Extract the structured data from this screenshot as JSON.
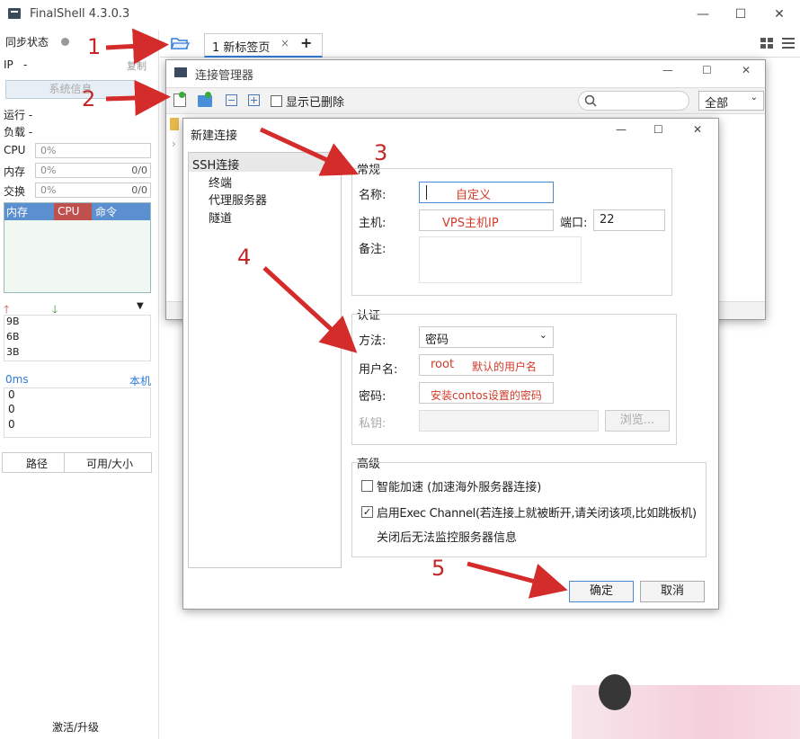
{
  "app": {
    "title": "FinalShell 4.3.0.3"
  },
  "left": {
    "sync_label": "同步状态",
    "ip_label": "IP",
    "ip_value": "-",
    "copy": "复制",
    "sysinfo": "系统信息",
    "run": "运行 -",
    "load": "负载 -",
    "meters": [
      {
        "label": "CPU",
        "value": "0%",
        "right": ""
      },
      {
        "label": "内存",
        "value": "0%",
        "right": "0/0"
      },
      {
        "label": "交换",
        "value": "0%",
        "right": "0/0"
      }
    ],
    "proc_tabs": [
      "内存",
      "CPU",
      "命令"
    ],
    "net_vals": [
      "9B",
      "6B",
      "3B"
    ],
    "ping": "0ms",
    "host": "本机",
    "ping_vals": [
      "0",
      "0",
      "0"
    ],
    "path": "路径",
    "size": "可用/大小",
    "activate": "激活/升级"
  },
  "tabs": {
    "label": "1 新标签页",
    "close": "×",
    "add": "+"
  },
  "conn_mgr": {
    "title": "连接管理器",
    "show_deleted": "显示已删除",
    "filter": "全部"
  },
  "dialog": {
    "title": "新建连接",
    "tree": [
      "SSH连接",
      "终端",
      "代理服务器",
      "隧道"
    ],
    "general": "常规",
    "name_label": "名称:",
    "name_value": "自定义",
    "host_label": "主机:",
    "host_value": "VPS主机IP",
    "port_label": "端口:",
    "port_value": "22",
    "note_label": "备注:",
    "auth": "认证",
    "method_label": "方法:",
    "method_value": "密码",
    "user_label": "用户名:",
    "user_value": "root",
    "user_note": "默认的用户名",
    "pass_label": "密码:",
    "pass_note": "安装contos设置的密码",
    "key_label": "私钥:",
    "browse": "浏览...",
    "advanced": "高级",
    "smart_accel": "智能加速 (加速海外服务器连接)",
    "exec_channel": "启用Exec Channel(若连接上就被断开,请关闭该项,比如跳板机)",
    "exec_note": "关闭后无法监控服务器信息",
    "ok": "确定",
    "cancel": "取消"
  },
  "annotations": [
    "1",
    "2",
    "3",
    "4",
    "5"
  ],
  "colors": {
    "accent": "#2f7ad8",
    "annotation": "#c32727",
    "proc_header": "#5b8fd0",
    "proc_cpu": "#c0504d"
  }
}
